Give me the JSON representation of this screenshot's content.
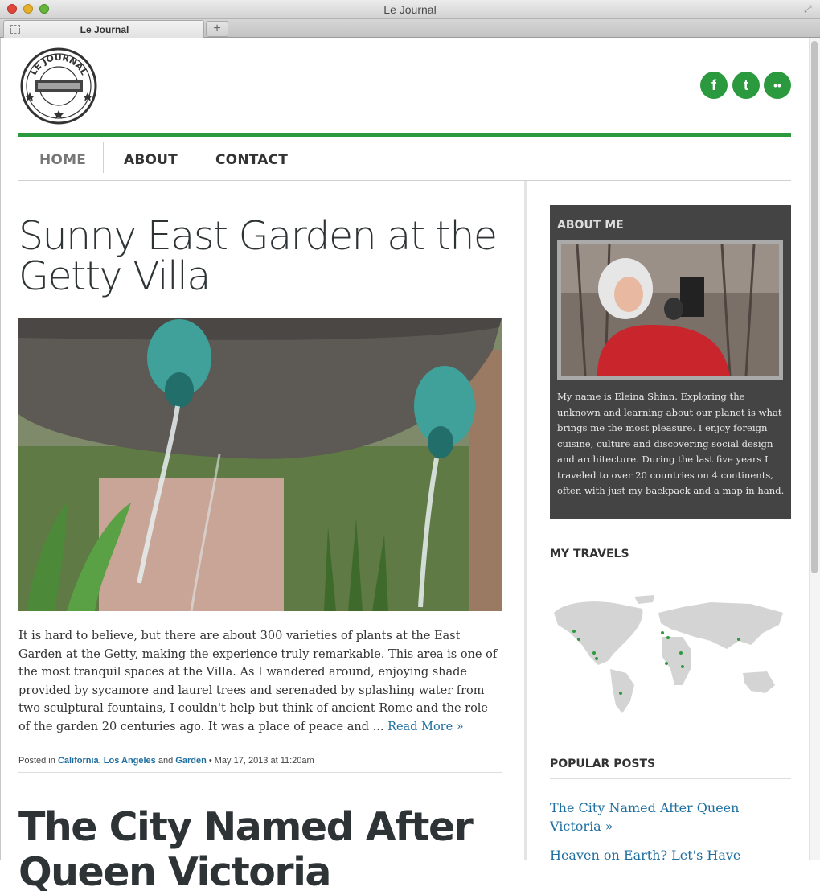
{
  "browser": {
    "window_title": "Le Journal",
    "tab_label": "Le Journal",
    "new_tab_symbol": "+"
  },
  "header": {
    "logo_alt": "Le Journal stamp logo",
    "logo_text_top": "LE JOURNAL",
    "logo_text_side": "LE JOURNAL",
    "social": {
      "facebook": "f",
      "twitter": "t",
      "flickr": "••"
    },
    "accent_color": "#2b9a3f"
  },
  "nav": {
    "items": [
      {
        "label": "HOME"
      },
      {
        "label": "ABOUT"
      },
      {
        "label": "CONTACT"
      }
    ]
  },
  "main": {
    "post1": {
      "title": "Sunny East Garden at the Getty Villa",
      "excerpt": "It is hard to believe, but there are about 300 varieties of plants at the East Garden at the Getty, making the experience truly remarkable. This area is one of the most tranquil spaces at the Villa. As I wandered around, enjoying shade provided by sycamore and laurel trees and serenaded by splashing water from two sculptural fountains, I couldn't help but think of ancient Rome and the role of the garden 20 centuries ago. It was a place of peace and ...",
      "read_more": "Read More »",
      "meta": {
        "posted_in": "Posted in",
        "cat1": "California",
        "sep1": ",",
        "cat2": "Los Angeles",
        "and": "and",
        "cat3": "Garden",
        "date": "• May 17, 2013 at 11:20am"
      }
    },
    "post2": {
      "title": "The City Named After Queen Victoria"
    }
  },
  "sidebar": {
    "about": {
      "heading": "ABOUT ME",
      "text": "My name is Eleina Shinn. Exploring the unknown and learning about our planet is what brings me the most pleasure. I enjoy foreign cuisine, culture and discovering social design and architecture. During the last five years I traveled to over 20 countries on 4 continents, often with just my backpack and a map in hand."
    },
    "travels": {
      "heading": "MY TRAVELS"
    },
    "popular": {
      "heading": "POPULAR POSTS",
      "posts": [
        {
          "title": "The City Named After Queen Victoria »"
        },
        {
          "title": "Heaven on Earth? Let's Have"
        }
      ]
    }
  }
}
